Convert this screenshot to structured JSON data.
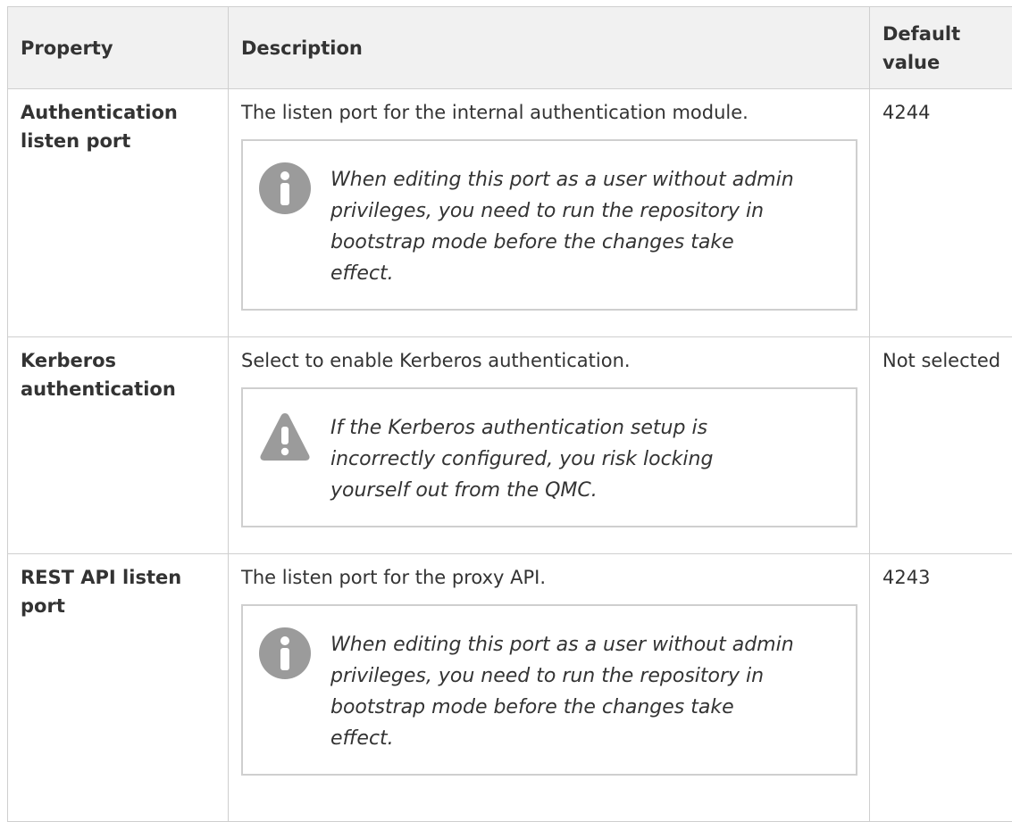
{
  "header": {
    "property": "Property",
    "description": "Description",
    "default": "Default value"
  },
  "rows": [
    {
      "property": "Authentication listen port",
      "description": "The listen port for the internal authentication module.",
      "note_icon": "info-icon",
      "note": "When editing this port as a user without admin privileges, you need to run the repository in bootstrap mode before the changes take effect.",
      "default": "4244"
    },
    {
      "property": "Kerberos authentication",
      "description": "Select to enable Kerberos authentication.",
      "note_icon": "warning-icon",
      "note": "If the Kerberos authentication setup is incorrectly configured, you risk locking yourself out from the QMC.",
      "default": "Not selected"
    },
    {
      "property": "REST API listen port",
      "description": "The listen port for the proxy API.",
      "note_icon": "info-icon",
      "note": "When editing this port as a user without admin privileges, you need to run the repository in bootstrap mode before the changes take effect.",
      "default": "4243"
    }
  ],
  "colors": {
    "icon": "#9b9b9b",
    "border": "#cfcfcf",
    "header_bg": "#f1f1f1"
  }
}
